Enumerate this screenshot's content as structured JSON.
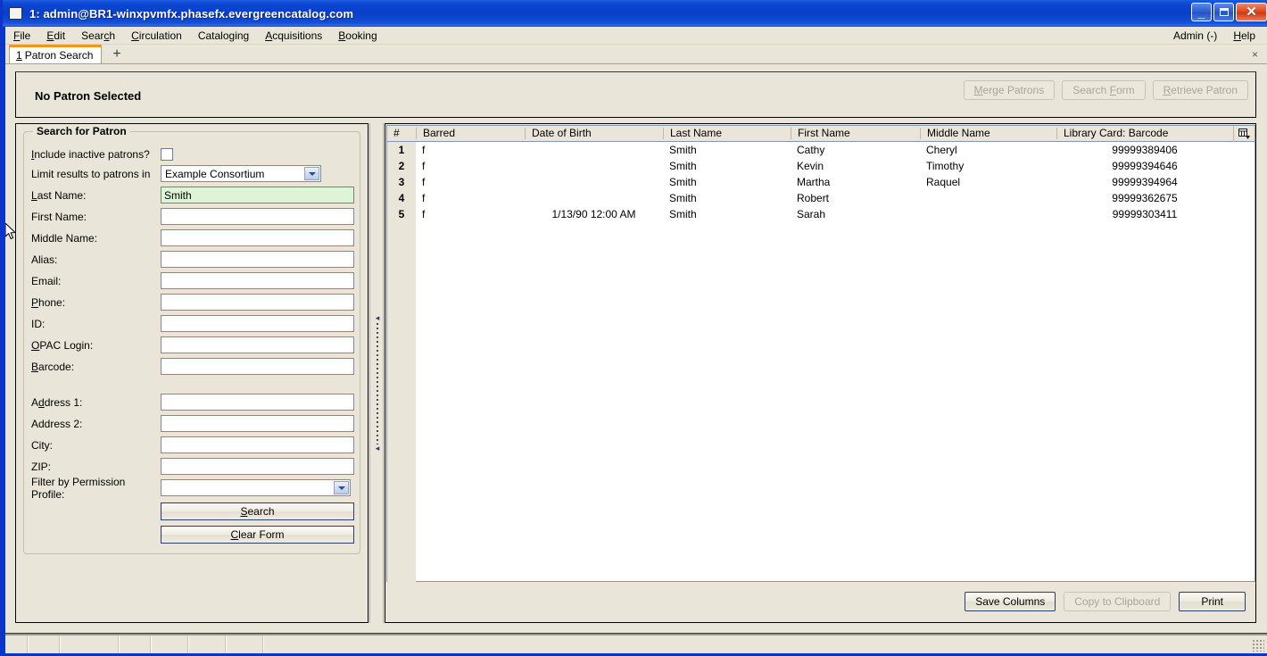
{
  "window": {
    "title": "1: admin@BR1-winxpvmfx.phasefx.evergreencatalog.com",
    "icon": "window-icon",
    "minimize_label": "_",
    "maximize_label": "",
    "close_label": "✕"
  },
  "menubar": {
    "items": [
      {
        "label": "File",
        "accel": "F"
      },
      {
        "label": "Edit",
        "accel": "E"
      },
      {
        "label": "Search",
        "accel": "c"
      },
      {
        "label": "Circulation",
        "accel": "C"
      },
      {
        "label": "Cataloging",
        "accel": "g"
      },
      {
        "label": "Acquisitions",
        "accel": "A"
      },
      {
        "label": "Booking",
        "accel": "B"
      }
    ],
    "right_items": [
      {
        "label": "Admin (-)"
      },
      {
        "label": "Help"
      }
    ]
  },
  "tabs": {
    "items": [
      {
        "index": "1",
        "label": "Patron Search"
      }
    ],
    "new_tab_label": "+",
    "close_label": "×"
  },
  "patron_strip": {
    "status": "No Patron Selected",
    "buttons": [
      {
        "label": "Merge Patrons",
        "disabled": true
      },
      {
        "label": "Search Form",
        "disabled": true
      },
      {
        "label": "Retrieve Patron",
        "disabled": true
      }
    ]
  },
  "search_form": {
    "title": "Search for Patron",
    "fields": [
      {
        "name": "include-inactive",
        "label": "Include inactive patrons?",
        "type": "checkbox",
        "checked": false
      },
      {
        "name": "limit-results",
        "label": "Limit results to patrons in",
        "type": "select",
        "value": "Example Consortium"
      },
      {
        "name": "last-name",
        "label": "Last Name:",
        "type": "text",
        "value": "Smith",
        "focused": true
      },
      {
        "name": "first-name",
        "label": "First Name:",
        "type": "text",
        "value": ""
      },
      {
        "name": "middle-name",
        "label": "Middle Name:",
        "type": "text",
        "value": ""
      },
      {
        "name": "alias",
        "label": "Alias:",
        "type": "text",
        "value": ""
      },
      {
        "name": "email",
        "label": "Email:",
        "type": "text",
        "value": ""
      },
      {
        "name": "phone",
        "label": "Phone:",
        "type": "text",
        "value": ""
      },
      {
        "name": "id",
        "label": "ID:",
        "type": "text",
        "value": ""
      },
      {
        "name": "opac-login",
        "label": "OPAC Login:",
        "type": "text",
        "value": ""
      },
      {
        "name": "barcode",
        "label": "Barcode:",
        "type": "text",
        "value": ""
      },
      {
        "name": "address-1",
        "label": "Address 1:",
        "type": "text",
        "value": ""
      },
      {
        "name": "address-2",
        "label": "Address 2:",
        "type": "text",
        "value": ""
      },
      {
        "name": "city",
        "label": "City:",
        "type": "text",
        "value": ""
      },
      {
        "name": "zip",
        "label": "ZIP:",
        "type": "text",
        "value": ""
      },
      {
        "name": "permission-profile",
        "label": "Filter by Permission Profile:",
        "type": "select",
        "value": ""
      }
    ],
    "search_button": "Search",
    "clear_button": "Clear Form"
  },
  "results": {
    "columns": [
      "#",
      "Barred",
      "Date of Birth",
      "Last Name",
      "First Name",
      "Middle Name",
      "Library Card: Barcode"
    ],
    "column_picker_icon": "column-picker-icon",
    "rows": [
      {
        "num": "1",
        "barred": "f",
        "dob": "",
        "last": "Smith",
        "first": "Cathy",
        "middle": "Cheryl",
        "card": "99999389406"
      },
      {
        "num": "2",
        "barred": "f",
        "dob": "",
        "last": "Smith",
        "first": "Kevin",
        "middle": "Timothy",
        "card": "99999394646"
      },
      {
        "num": "3",
        "barred": "f",
        "dob": "",
        "last": "Smith",
        "first": "Martha",
        "middle": "Raquel",
        "card": "99999394964"
      },
      {
        "num": "4",
        "barred": "f",
        "dob": "",
        "last": "Smith",
        "first": "Robert",
        "middle": "",
        "card": "99999362675"
      },
      {
        "num": "5",
        "barred": "f",
        "dob": "1/13/90 12:00 AM",
        "last": "Smith",
        "first": "Sarah",
        "middle": "",
        "card": "99999303411"
      }
    ],
    "footer_buttons": [
      {
        "label": "Save Columns",
        "disabled": false
      },
      {
        "label": "Copy to Clipboard",
        "disabled": true
      },
      {
        "label": "Print",
        "disabled": false
      }
    ]
  },
  "colors": {
    "titlebar_blue": "#0a3fc8",
    "chrome": "#e9e6d9",
    "tab_accent": "#f0951e",
    "active_field": "#ddf4d6",
    "frame": "#0a35c8"
  }
}
